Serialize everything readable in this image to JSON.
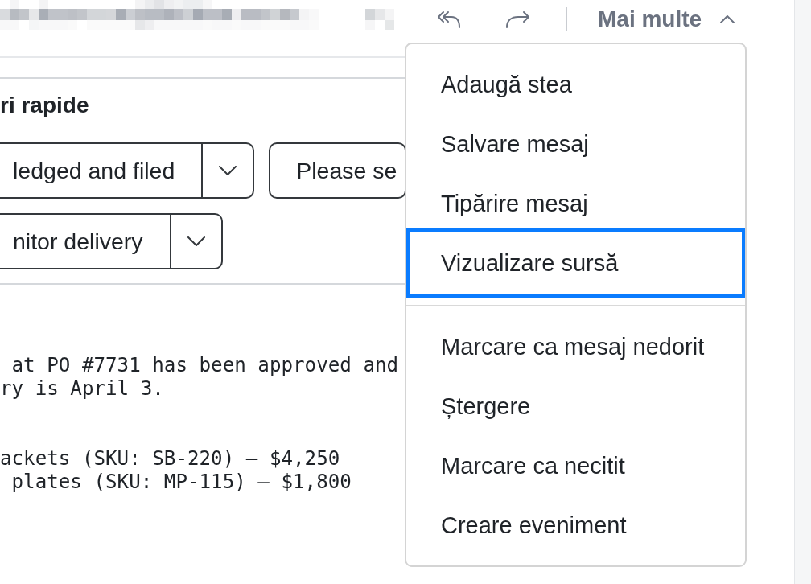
{
  "toolbar": {
    "more": {
      "label": "Mai multe",
      "expanded": true
    }
  },
  "quick_replies": {
    "title": "ri rapide",
    "buttons": [
      {
        "label": "ledged and filed",
        "kind": "split"
      },
      {
        "label": "Please se",
        "kind": "plain"
      },
      {
        "label": "nitor delivery",
        "kind": "split"
      }
    ]
  },
  "message": {
    "paragraphs": [
      [
        " at PO #7731 has been approved and",
        "ry is April 3."
      ],
      [
        "ackets (SKU: SB-220) — $4,250",
        " plates (SKU: MP-115) — $1,800"
      ]
    ]
  },
  "menu": {
    "groups": [
      [
        {
          "label": "Adaugă stea",
          "selected": false
        },
        {
          "label": "Salvare mesaj",
          "selected": false
        },
        {
          "label": "Tipărire mesaj",
          "selected": false
        },
        {
          "label": "Vizualizare sursă",
          "selected": true
        }
      ],
      [
        {
          "label": "Marcare ca mesaj nedorit",
          "selected": false
        },
        {
          "label": "Ștergere",
          "selected": false
        },
        {
          "label": "Marcare ca necitit",
          "selected": false
        },
        {
          "label": "Creare eveniment",
          "selected": false
        }
      ]
    ]
  }
}
